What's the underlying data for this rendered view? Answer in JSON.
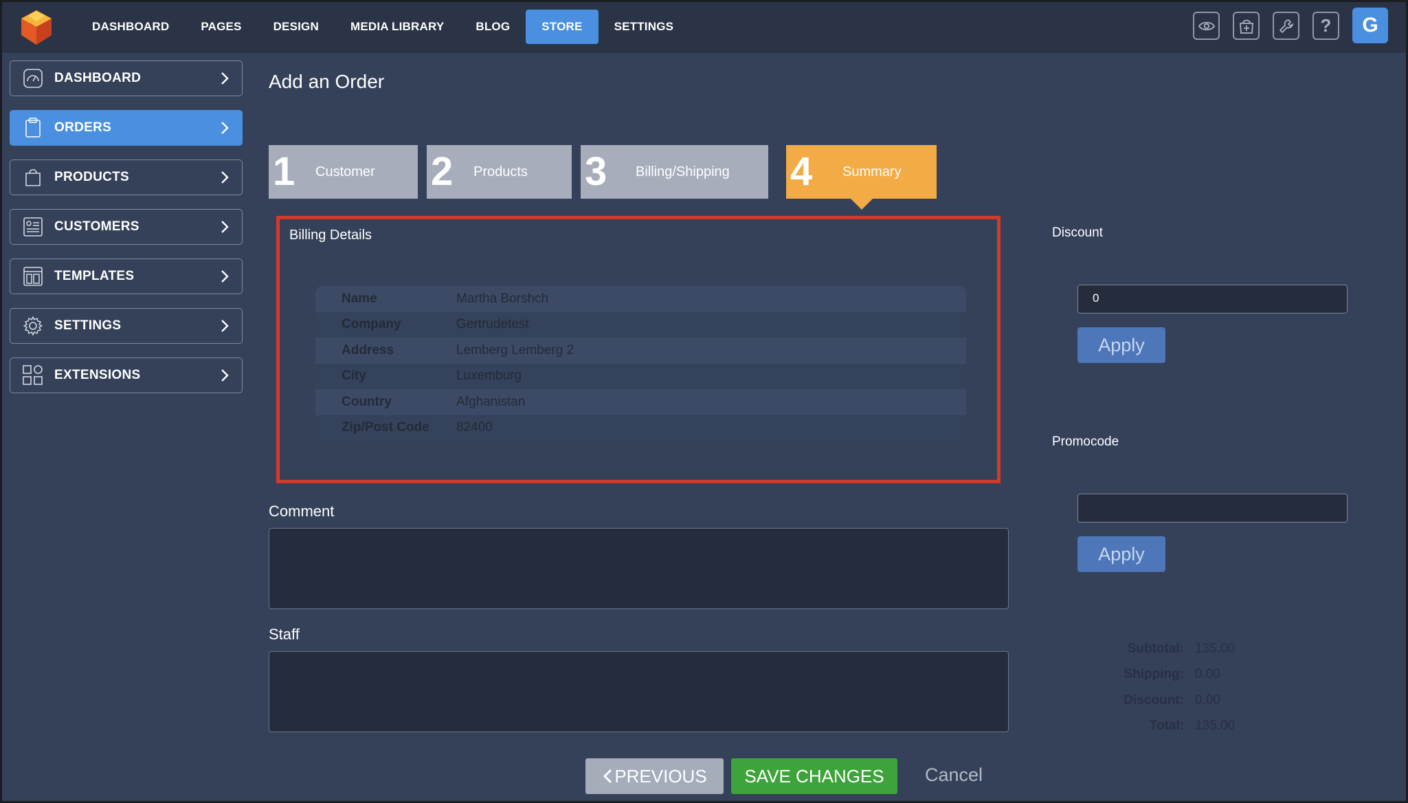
{
  "topnav": {
    "items": [
      "DASHBOARD",
      "PAGES",
      "DESIGN",
      "MEDIA LIBRARY",
      "BLOG",
      "STORE",
      "SETTINGS"
    ],
    "active": "STORE",
    "avatar_letter": "G",
    "icons": [
      "eye-icon",
      "store-add-icon",
      "wrench-icon",
      "help-icon"
    ]
  },
  "sidebar": {
    "items": [
      {
        "label": "DASHBOARD",
        "icon": "gauge-icon"
      },
      {
        "label": "ORDERS",
        "icon": "clipboard-icon"
      },
      {
        "label": "PRODUCTS",
        "icon": "bag-icon"
      },
      {
        "label": "CUSTOMERS",
        "icon": "contact-card-icon"
      },
      {
        "label": "TEMPLATES",
        "icon": "layout-icon"
      },
      {
        "label": "SETTINGS",
        "icon": "gear-icon"
      },
      {
        "label": "EXTENSIONS",
        "icon": "grid-icon"
      }
    ],
    "active": "ORDERS"
  },
  "page": {
    "title": "Add an Order"
  },
  "steps": [
    {
      "num": "1",
      "label": "Customer"
    },
    {
      "num": "2",
      "label": "Products"
    },
    {
      "num": "3",
      "label": "Billing/Shipping"
    },
    {
      "num": "4",
      "label": "Summary"
    }
  ],
  "billing": {
    "title": "Billing Details",
    "rows": [
      {
        "key": "Name",
        "value": "Martha Borshch"
      },
      {
        "key": "Company",
        "value": "Gertrudetest"
      },
      {
        "key": "Address",
        "value": "Lemberg Lemberg 2"
      },
      {
        "key": "City",
        "value": "Luxemburg"
      },
      {
        "key": "Country",
        "value": "Afghanistan"
      },
      {
        "key": "Zip/Post Code",
        "value": "82400"
      }
    ]
  },
  "comment": {
    "label": "Comment",
    "value": ""
  },
  "staff": {
    "label": "Staff",
    "value": ""
  },
  "discount": {
    "label": "Discount",
    "value": "0",
    "apply_label": "Apply"
  },
  "promocode": {
    "label": "Promocode",
    "value": "",
    "apply_label": "Apply"
  },
  "totals": {
    "subtotal_label": "Subtotal:",
    "subtotal": "135.00",
    "shipping_label": "Shipping:",
    "shipping": "0.00",
    "discount_label": "Discount:",
    "discount": "0.00",
    "total_label": "Total:",
    "total": "135.00"
  },
  "actions": {
    "previous": "PREVIOUS",
    "save": "SAVE CHANGES",
    "cancel": "Cancel"
  },
  "colors": {
    "accent": "#4a8fe0",
    "step_active": "#f3ab45",
    "highlight_border": "#d5392a",
    "save": "#3ea33a"
  }
}
